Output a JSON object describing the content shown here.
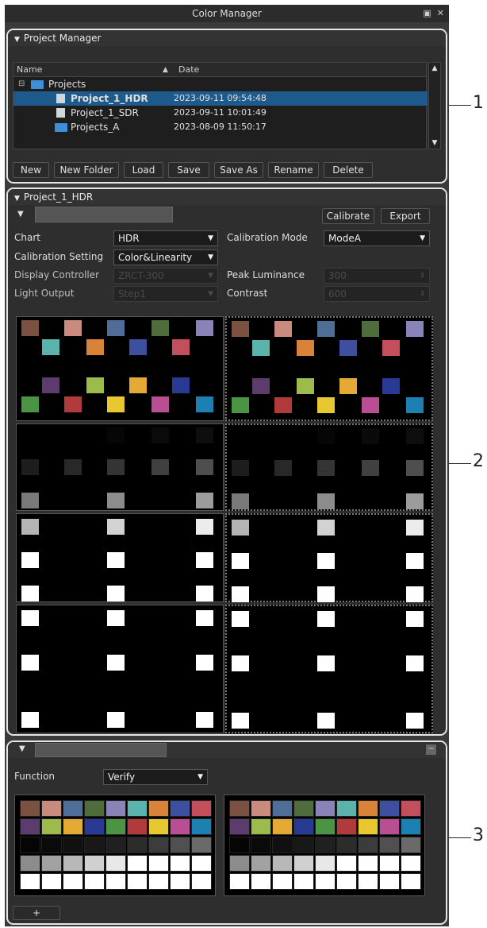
{
  "window": {
    "title": "Color Manager"
  },
  "project_manager": {
    "header": "Project Manager",
    "columns": [
      "Name",
      "Date"
    ],
    "rows": [
      {
        "name": "Projects",
        "date": "",
        "type": "folder",
        "indent": 0
      },
      {
        "name": "Project_1_HDR",
        "date": "2023-09-11 09:54:48",
        "type": "file",
        "indent": 1,
        "selected": true
      },
      {
        "name": "Project_1_SDR",
        "date": "2023-09-11 10:01:49",
        "type": "file",
        "indent": 1
      },
      {
        "name": "Projects_A",
        "date": "2023-08-09 11:50:17",
        "type": "folder",
        "indent": 1
      }
    ],
    "buttons": [
      "New",
      "New Folder",
      "Load",
      "Save",
      "Save As",
      "Rename",
      "Delete"
    ]
  },
  "project": {
    "header": "Project_1_HDR",
    "calibrate": "Calibrate",
    "export": "Export",
    "chart_label": "Chart",
    "chart_value": "HDR",
    "cal_mode_label": "Calibration Mode",
    "cal_mode_value": "ModeA",
    "cal_setting_label": "Calibration Setting",
    "cal_setting_value": "Color&Linearity",
    "display_controller_label": "Display Controller",
    "display_controller_value": "ZRCT-300",
    "peak_lum_label": "Peak Luminance",
    "peak_lum_value": "300",
    "light_output_label": "Light Output",
    "light_output_value": "Step1",
    "contrast_label": "Contrast",
    "contrast_value": "600"
  },
  "function_panel": {
    "function_label": "Function",
    "function_value": "Verify",
    "add_label": "+"
  },
  "callouts": [
    "1",
    "2",
    "3"
  ],
  "colors": {
    "colorchecker": [
      "#7b5141",
      "#c98b7d",
      "#4e6e98",
      "#4f6c3c",
      "#8884b8",
      "#5bb3ad",
      "#d9823a",
      "#3e4fa0",
      "#c44f5c",
      "#5c3c6c",
      "#9dba4c",
      "#e5a935",
      "#283a94",
      "#4a9444",
      "#b03a3c",
      "#e7c831",
      "#b94e95",
      "#1c81b2"
    ],
    "gray_dark": [
      "#050505",
      "#0a0a0a",
      "#101010",
      "#181818",
      "#202020",
      "#2c2c2c",
      "#3c3c3c",
      "#505050",
      "#6a6a6a"
    ],
    "gray_light": [
      "#8c8c8c",
      "#a2a2a2",
      "#b8b8b8",
      "#d0d0d0",
      "#e8e8e8",
      "#ffffff",
      "#ffffff",
      "#ffffff",
      "#ffffff"
    ]
  }
}
